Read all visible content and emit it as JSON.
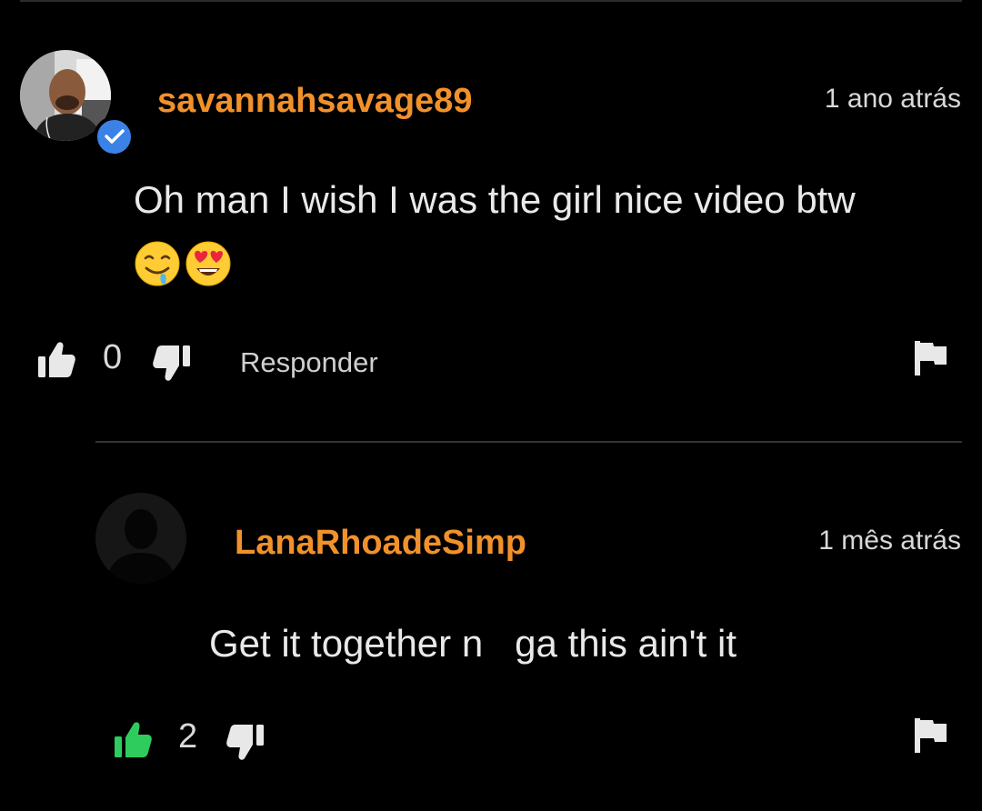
{
  "colors": {
    "username": "#f1912b",
    "like_active": "#2ecc5c",
    "icon_default": "#e8e8e8",
    "verified": "#3b82e6"
  },
  "comments": [
    {
      "username": "savannahsavage89",
      "timestamp": "1 ano atrás",
      "text": "Oh man I wish I was the girl nice video btw",
      "emojis": [
        "drooling-face",
        "heart-eyes"
      ],
      "likes": "0",
      "reply_label": "Responder",
      "verified": true,
      "liked": false
    },
    {
      "username": "LanaRhoadeSimp",
      "timestamp": "1 mês atrás",
      "text": "Get it together n   ga this ain't it",
      "likes": "2",
      "verified": false,
      "liked": true
    }
  ]
}
